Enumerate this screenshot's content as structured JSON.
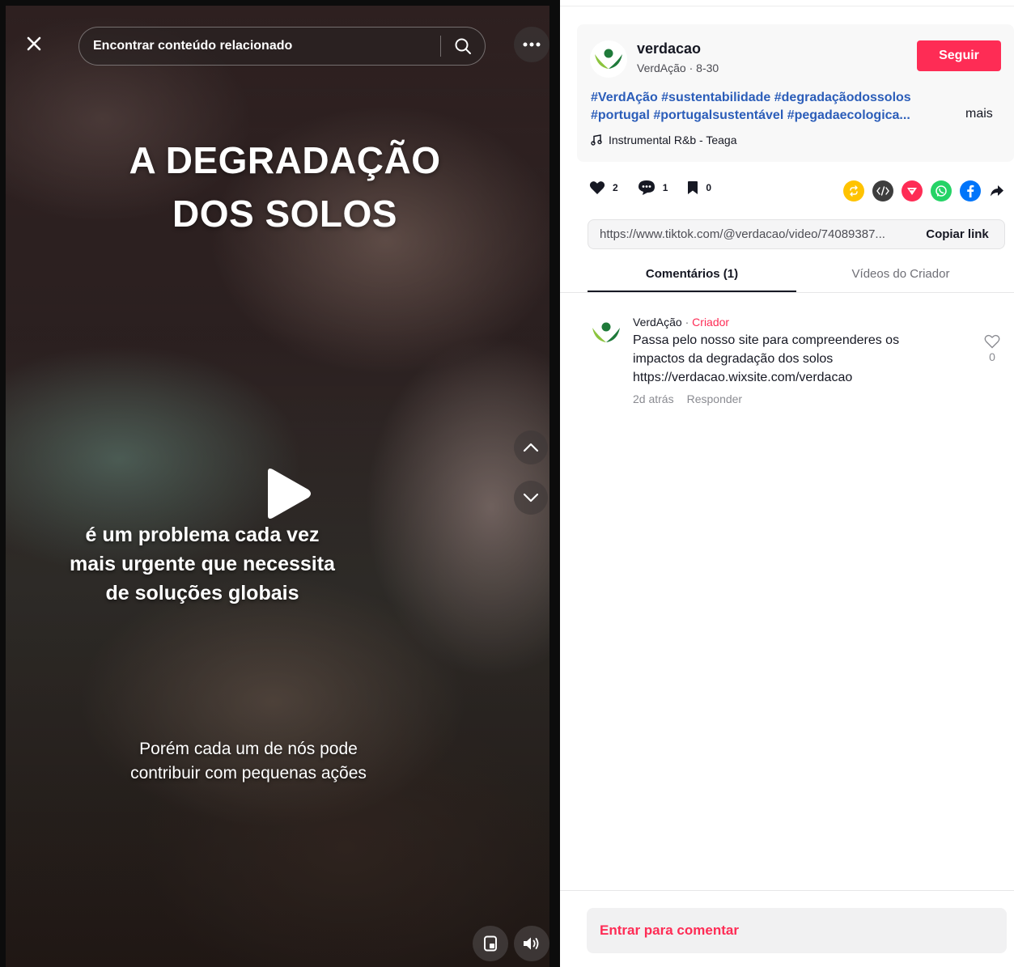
{
  "video": {
    "search_placeholder": "Encontrar conteúdo relacionado",
    "overlay_title_line1": "A DEGRADAÇÃO",
    "overlay_title_line2": "DOS SOLOS",
    "overlay_text_1": "é um problema cada vez mais urgente que necessita de soluções globais",
    "overlay_text_2": "Porém cada um de nós pode contribuir com pequenas ações"
  },
  "post": {
    "username": "verdacao",
    "display_name": "VerdAção",
    "separator": " · ",
    "date": "8-30",
    "follow_label": "Seguir",
    "hashtags_line1": "#VerdAção #sustentabilidade #degradaçãodossolos",
    "hashtags_line2": "#portugal #portugalsustentável #pegadaecologica...",
    "more_label": "mais",
    "music": "Instrumental R&b - Teaga"
  },
  "actions": {
    "likes": "2",
    "comments": "1",
    "saves": "0"
  },
  "share": {
    "icons": [
      "repost-icon",
      "embed-icon",
      "send-icon",
      "whatsapp-icon",
      "facebook-icon",
      "share-arrow-icon"
    ],
    "colors": {
      "repost": "#ffc300",
      "embed": "#3d3d3d",
      "send": "#fe2c55",
      "whatsapp": "#25d366",
      "facebook": "#0075fa"
    }
  },
  "link": {
    "url": "https://www.tiktok.com/@verdacao/video/74089387...",
    "copy_label": "Copiar link"
  },
  "tabs": {
    "comments": "Comentários (1)",
    "creator_videos": "Vídeos do Criador"
  },
  "comment": {
    "author": "VerdAção",
    "separator": " · ",
    "badge": "Criador",
    "line1": "Passa pelo nosso site para compreenderes os",
    "line2": "impactos da degradação dos solos",
    "line3": "https://verdacao.wixsite.com/verdacao",
    "time": "2d atrás",
    "reply_label": "Responder",
    "like_count": "0"
  },
  "login": {
    "label": "Entrar para comentar"
  },
  "colors": {
    "accent": "#fe2c55",
    "hashtag": "#2b5db9",
    "text": "#161823"
  }
}
